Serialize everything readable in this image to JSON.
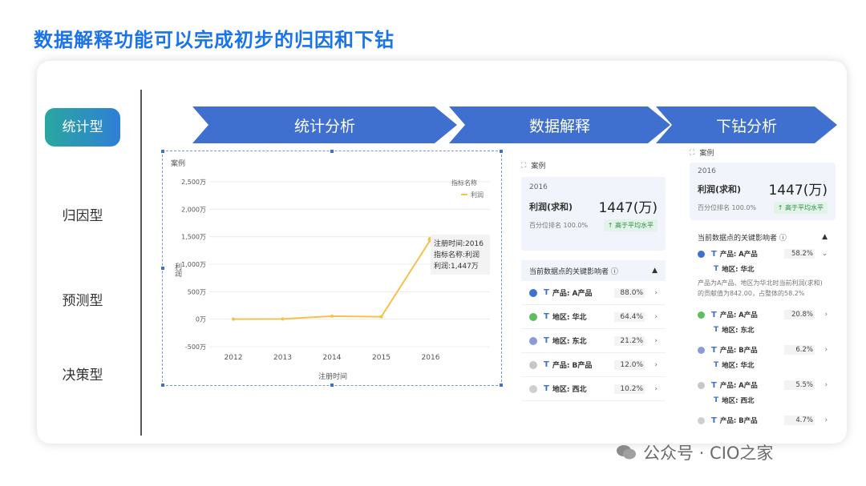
{
  "page_title": "数据解释功能可以完成初步的归因和下钻",
  "nav": [
    "统计型",
    "归因型",
    "预测型",
    "决策型"
  ],
  "steps": [
    "统计分析",
    "数据解释",
    "下钻分析"
  ],
  "chart": {
    "tag": "案例",
    "legend_title": "指标名称",
    "legend_item": "利润",
    "tooltip": [
      "注册时间:2016",
      "指标名称:利润",
      "利润:1,447万"
    ],
    "colors": {
      "line": "#f6c14b"
    },
    "chart_data": {
      "type": "line",
      "categories": [
        "2012",
        "2013",
        "2014",
        "2015",
        "2016"
      ],
      "series": [
        {
          "name": "利润",
          "values": [
            0,
            5,
            55,
            45,
            1447
          ]
        }
      ],
      "xlabel": "注册时间",
      "ylabel": "利润",
      "ylim": [
        -500,
        2500
      ],
      "yticks": [
        -500,
        0,
        500,
        1000,
        1500,
        2000,
        2500
      ],
      "ytick_labels": [
        "-500万",
        "0万",
        "500万",
        "1,000万",
        "1,500万",
        "2,000万",
        "2,500万"
      ],
      "legend_position": "top-right",
      "grid": true
    }
  },
  "explain": {
    "tag": "案例",
    "year": "2016",
    "metric": "利润(求和)",
    "value": "1447(万)",
    "rank": "百分位排名 100.0%",
    "badge": "高于平均水平",
    "factors_title": "当前数据点的关键影响者",
    "factors": [
      {
        "label": "产品: A产品",
        "pct": "88.0%",
        "color": "#3f6fcf"
      },
      {
        "label": "地区: 华北",
        "pct": "64.4%",
        "color": "#5cbf5c"
      },
      {
        "label": "地区: 东北",
        "pct": "21.2%",
        "color": "#8c9bd6"
      },
      {
        "label": "产品: B产品",
        "pct": "12.0%",
        "color": "#c7c7c7"
      },
      {
        "label": "地区: 西北",
        "pct": "10.2%",
        "color": "#cfcfcf"
      }
    ]
  },
  "drill": {
    "tag": "案例",
    "year": "2016",
    "metric": "利润(求和)",
    "value": "1447(万)",
    "rank": "百分位排名 100.0%",
    "badge": "高于平均水平",
    "factors_title": "当前数据点的关键影响者",
    "expanded": {
      "label": "产品: A产品",
      "pct": "58.2%",
      "sub": "地区: 华北",
      "desc": "产品为A产品、地区为华北时当前利润(求和)的贡献值为842.00，占整体的58.2%"
    },
    "items": [
      {
        "label": "产品: A产品",
        "pct": "20.8%",
        "sub": "地区: 东北",
        "color": "#5cbf5c"
      },
      {
        "label": "产品: B产品",
        "pct": "6.2%",
        "sub": "地区: 华北",
        "color": "#8c9bd6"
      },
      {
        "label": "产品: A产品",
        "pct": "5.5%",
        "sub": "地区: 西北",
        "color": "#c7c7c7"
      },
      {
        "label": "产品: B产品",
        "pct": "4.7%",
        "color": "#cfcfcf"
      }
    ]
  },
  "watermark": "公众号 · CIO之家"
}
